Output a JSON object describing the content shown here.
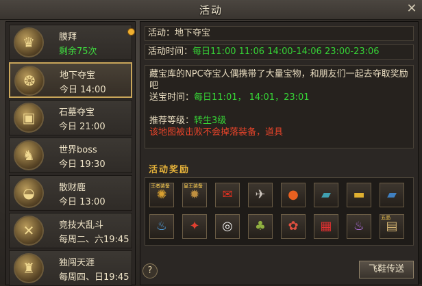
{
  "window": {
    "title": "活动",
    "close": "✕"
  },
  "activities": [
    {
      "name": "膜拜",
      "time": "剩余75次",
      "time_green": true,
      "icon": "statue-icon",
      "glyph": "♛",
      "badge": true
    },
    {
      "name": "地下夺宝",
      "time": "今日 14:00",
      "active": true,
      "icon": "treasure-sack-icon",
      "glyph": "❂"
    },
    {
      "name": "石墓夺宝",
      "time": "今日 21:00",
      "icon": "treasure-chest-icon",
      "glyph": "▣"
    },
    {
      "name": "世界boss",
      "time": "今日 19:30",
      "icon": "demon-boss-icon",
      "glyph": "♞"
    },
    {
      "name": "散财鹿",
      "time": "今日 13:00",
      "icon": "gold-ingot-icon",
      "glyph": "◒"
    },
    {
      "name": "竞技大乱斗",
      "time": "每周二、六19:45",
      "icon": "crossed-swords-icon",
      "glyph": "✕"
    },
    {
      "name": "独闯天涯",
      "time": "每周四、日19:45",
      "icon": "warrior-icon",
      "glyph": "♜"
    }
  ],
  "detail": {
    "activity_label": "活动：",
    "activity_value": "地下夺宝",
    "time_label": "活动时间：",
    "time_value": "每日11:00  11:06 14:00-14:06 23:00-23:06",
    "desc": "藏宝库的NPC夺宝人偶携带了大量宝物，和朋友们一起去夺取奖励吧",
    "delivery_label": "送宝时间：",
    "delivery_value": "每日11:01，  14:01，23:01",
    "level_label": "推荐等级：",
    "level_value": "转生3级",
    "warning": "该地图被击败不会掉落装备，道具"
  },
  "rewards": {
    "title": "活动奖励",
    "items": [
      {
        "icon": "golden-dragon-equip-icon",
        "glyph": "✺",
        "color": "#d9a030",
        "tag": "王者装备"
      },
      {
        "icon": "emperor-equip-icon",
        "glyph": "✹",
        "color": "#c09040",
        "tag": "皇王装备"
      },
      {
        "icon": "red-envelope-icon",
        "glyph": "✉",
        "color": "#e03020"
      },
      {
        "icon": "winged-helmet-icon",
        "glyph": "✈",
        "color": "#d0c8c0"
      },
      {
        "icon": "fire-orb-icon",
        "glyph": "●",
        "color": "#e86020"
      },
      {
        "icon": "skill-book-icon",
        "glyph": "▰",
        "color": "#40a0b0"
      },
      {
        "icon": "gold-bar-icon",
        "glyph": "▬",
        "color": "#e0b030"
      },
      {
        "icon": "blue-book-icon",
        "glyph": "▰",
        "color": "#4080c0"
      },
      {
        "icon": "blue-potion-icon",
        "glyph": "♨",
        "color": "#50a0e0"
      },
      {
        "icon": "red-wing-icon",
        "glyph": "✦",
        "color": "#e04030"
      },
      {
        "icon": "lifebuoy-icon",
        "glyph": "◎",
        "color": "#f0f0f0"
      },
      {
        "icon": "gourd-icon",
        "glyph": "♣",
        "color": "#90b040"
      },
      {
        "icon": "lucky-bag-icon",
        "glyph": "✿",
        "color": "#e05040"
      },
      {
        "icon": "gift-box-icon",
        "glyph": "▦",
        "color": "#e03030"
      },
      {
        "icon": "magic-potion-icon",
        "glyph": "♨",
        "color": "#b070e0"
      },
      {
        "icon": "five-star-scroll-icon",
        "glyph": "▤",
        "color": "#d0b070",
        "tag": "五品"
      }
    ]
  },
  "help": "?",
  "fly_button": "飞鞋传送"
}
